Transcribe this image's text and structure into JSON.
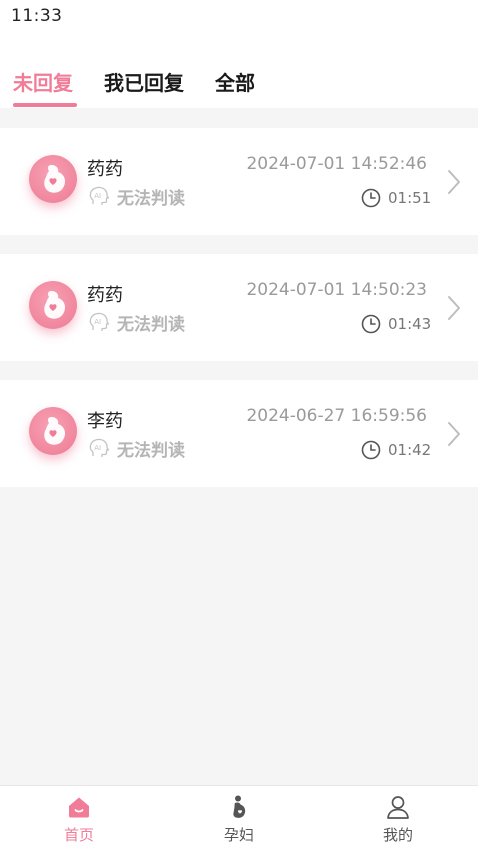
{
  "status_bar": {
    "time": "11:33"
  },
  "tabs": [
    {
      "label": "未回复",
      "active": true
    },
    {
      "label": "我已回复",
      "active": false
    },
    {
      "label": "全部",
      "active": false
    }
  ],
  "records": [
    {
      "name": "药药",
      "ai_status": "无法判读",
      "datetime": "2024-07-01 14:52:46",
      "duration": "01:51"
    },
    {
      "name": "药药",
      "ai_status": "无法判读",
      "datetime": "2024-07-01 14:50:23",
      "duration": "01:43"
    },
    {
      "name": "李药",
      "ai_status": "无法判读",
      "datetime": "2024-06-27 16:59:56",
      "duration": "01:42"
    }
  ],
  "bottom_nav": [
    {
      "label": "首页",
      "icon": "home-icon",
      "active": true
    },
    {
      "label": "孕妇",
      "icon": "pregnant-icon",
      "active": false
    },
    {
      "label": "我的",
      "icon": "profile-icon",
      "active": false
    }
  ],
  "colors": {
    "accent": "#f07c98",
    "muted": "#b5b5b5",
    "background": "#f5f5f5"
  }
}
